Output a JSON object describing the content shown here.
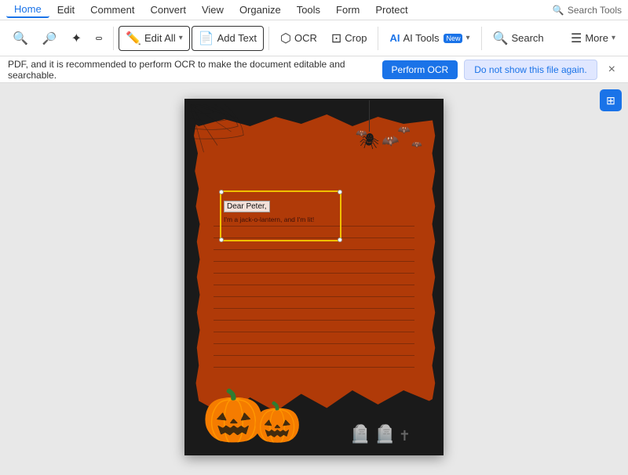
{
  "menubar": {
    "items": [
      {
        "label": "Home",
        "active": true
      },
      {
        "label": "Edit",
        "active": false
      },
      {
        "label": "Comment",
        "active": false
      },
      {
        "label": "Convert",
        "active": false
      },
      {
        "label": "View",
        "active": false
      },
      {
        "label": "Organize",
        "active": false
      },
      {
        "label": "Tools",
        "active": false
      },
      {
        "label": "Form",
        "active": false
      },
      {
        "label": "Protect",
        "active": false
      }
    ],
    "search_tools_label": "Search Tools",
    "search_placeholder": "Search Tools"
  },
  "toolbar": {
    "zoom_out_label": "🔍",
    "zoom_in_label": "🔍",
    "marquee_label": "◇",
    "rect_label": "□",
    "edit_all_label": "Edit All",
    "add_text_label": "Add Text",
    "ocr_label": "OCR",
    "crop_label": "Crop",
    "ai_tools_label": "AI Tools",
    "ai_new_badge": "New",
    "search_label": "Search",
    "more_label": "More"
  },
  "notification": {
    "text": "PDF, and it is recommended to perform OCR to make the document editable and searchable.",
    "perform_ocr_btn": "Perform OCR",
    "dont_show_btn": "Do not show this file again.",
    "close_label": "×"
  },
  "document": {
    "dear_peter": "Dear Peter,",
    "body_text": "I'm a jack-o-lantern, and I'm lit!",
    "page_panel_icon": "⊞"
  }
}
